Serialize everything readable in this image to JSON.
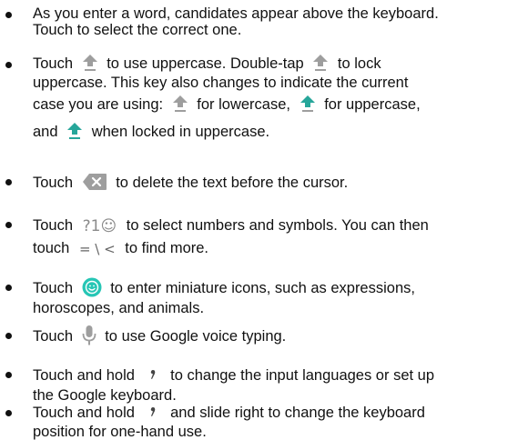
{
  "items": [
    {
      "lines": [
        "As you enter a word, candidates appear above the keyboard.",
        "Touch to select the correct one."
      ]
    },
    {
      "l1_a": "Touch",
      "l1_b": "to use uppercase. Double-tap",
      "l1_c": "to lock",
      "l2": "uppercase. This key also changes to indicate the current",
      "l3_a": "case you are using:",
      "l3_b": "for lowercase,",
      "l3_c": "for uppercase,",
      "l4_a": "and",
      "l4_b": "when locked in uppercase."
    },
    {
      "a": "Touch",
      "b": "to delete the text before the cursor."
    },
    {
      "l1_a": "Touch",
      "symbols_key": "?1☺",
      "l1_b": "to select numbers and symbols. You can then",
      "l2_a": "touch",
      "more_key": "= \\ <",
      "l2_b": "to find more."
    },
    {
      "l1_a": "Touch",
      "l1_b": "to enter miniature icons, such as expressions,",
      "l2": "horoscopes, and animals."
    },
    {
      "a": "Touch",
      "b": "to use Google voice typing."
    },
    {
      "l1_a": "Touch and hold",
      "l1_b": "to change the input languages or set up",
      "l2": "the Google keyboard."
    },
    {
      "l1_a": "Touch and hold",
      "l1_b": "and slide right to change the keyboard",
      "l2": "position for one-hand use."
    }
  ],
  "icons": {
    "shift_lowercase": "shift-lowercase-icon",
    "shift_uppercase": "shift-uppercase-icon",
    "shift_locked": "shift-locked-icon",
    "delete": "delete-icon",
    "emoji": "emoji-icon",
    "microphone": "microphone-icon",
    "comma_key": "comma-key-icon"
  },
  "colors": {
    "accent": "#26a69a",
    "icon_gray": "#9e9e9e",
    "text": "#111111"
  }
}
